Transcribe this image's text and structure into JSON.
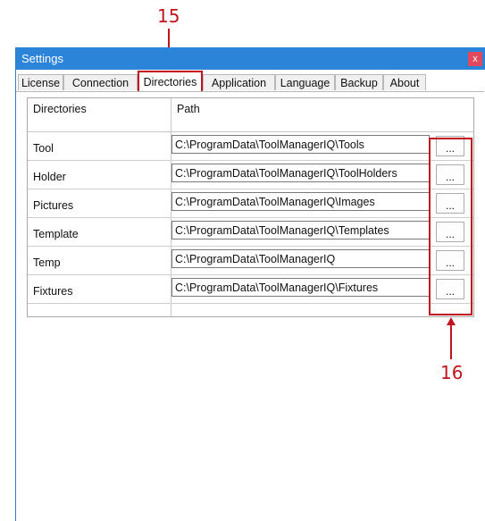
{
  "callouts": {
    "tabs_callout": "15",
    "browse_callout": "16"
  },
  "window": {
    "title": "Settings",
    "close_label": "x"
  },
  "tabs": [
    {
      "label": "License"
    },
    {
      "label": "Connection"
    },
    {
      "label": "Directories",
      "active": true
    },
    {
      "label": "Application"
    },
    {
      "label": "Language"
    },
    {
      "label": "Backup"
    },
    {
      "label": "About"
    }
  ],
  "grid": {
    "header_directories": "Directories",
    "header_path": "Path",
    "rows": [
      {
        "label": "Tool",
        "path": "C:\\ProgramData\\ToolManagerIQ\\Tools",
        "button": "..."
      },
      {
        "label": "Holder",
        "path": "C:\\ProgramData\\ToolManagerIQ\\ToolHolders",
        "button": "..."
      },
      {
        "label": "Pictures",
        "path": "C:\\ProgramData\\ToolManagerIQ\\Images",
        "button": "..."
      },
      {
        "label": "Template",
        "path": "C:\\ProgramData\\ToolManagerIQ\\Templates",
        "button": "..."
      },
      {
        "label": "Temp",
        "path": "C:\\ProgramData\\ToolManagerIQ",
        "button": "..."
      },
      {
        "label": "Fixtures",
        "path": "C:\\ProgramData\\ToolManagerIQ\\Fixtures",
        "button": "..."
      }
    ]
  },
  "colors": {
    "titlebar": "#2b84d8",
    "close_button": "#e0495b",
    "callout": "#c0121f"
  }
}
